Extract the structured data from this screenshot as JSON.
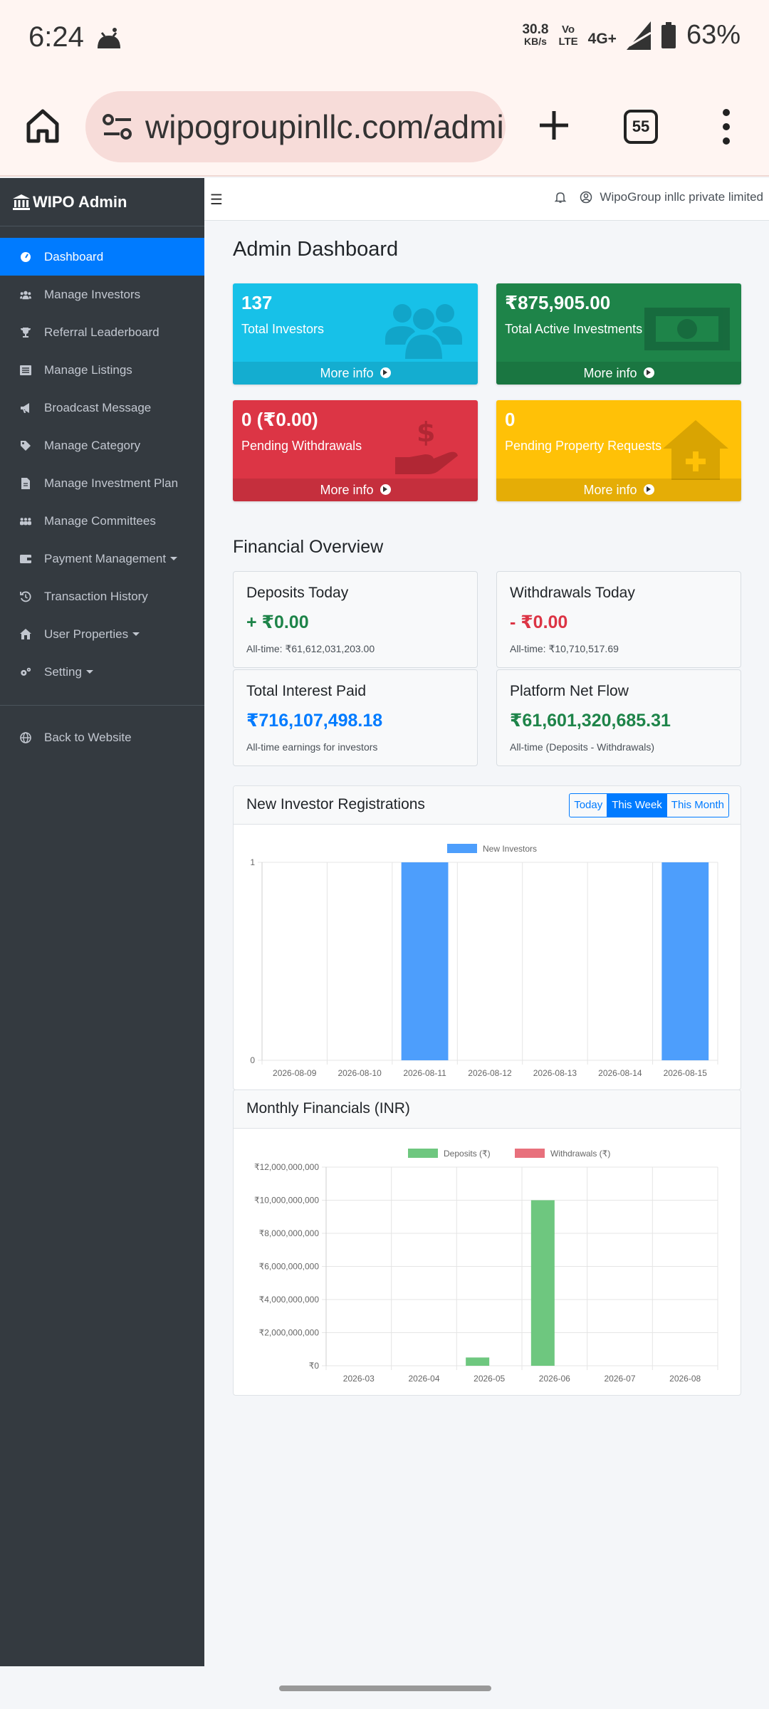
{
  "status_bar": {
    "time": "6:24",
    "speed_value": "30.8",
    "speed_unit": "KB/s",
    "volte_top": "Vo",
    "volte_bottom": "LTE",
    "network": "4G+",
    "battery": "63%"
  },
  "browser": {
    "url": "wipogroupinllc.com/admin/dashboard",
    "tab_count": "55"
  },
  "sidebar": {
    "brand": "WIPO Admin",
    "items": [
      {
        "label": "Dashboard",
        "icon": "gauge-icon",
        "active": true
      },
      {
        "label": "Manage Investors",
        "icon": "users-icon"
      },
      {
        "label": "Referral Leaderboard",
        "icon": "trophy-icon"
      },
      {
        "label": "Manage Listings",
        "icon": "list-icon"
      },
      {
        "label": "Broadcast Message",
        "icon": "megaphone-icon"
      },
      {
        "label": "Manage Category",
        "icon": "tags-icon"
      },
      {
        "label": "Manage Investment Plan",
        "icon": "file-icon"
      },
      {
        "label": "Manage Committees",
        "icon": "group-icon"
      },
      {
        "label": "Payment Management",
        "icon": "wallet-icon",
        "dropdown": true
      },
      {
        "label": "Transaction History",
        "icon": "history-icon"
      },
      {
        "label": "User Properties",
        "icon": "house-icon",
        "dropdown": true
      },
      {
        "label": "Setting",
        "icon": "gears-icon",
        "dropdown": true
      }
    ],
    "back_label": "Back to Website"
  },
  "topbar": {
    "user": "WipoGroup inllc private limited"
  },
  "page_title": "Admin Dashboard",
  "stats": [
    {
      "value": "137",
      "label": "Total Investors",
      "more": "More info",
      "color": "#17c1e8",
      "icon": "users-icon"
    },
    {
      "value": "₹875,905.00",
      "label": "Total Active Investments",
      "more": "More info",
      "color": "#1e8449",
      "icon": "money-icon"
    },
    {
      "value": "0 (₹0.00)",
      "label": "Pending Withdrawals",
      "more": "More info",
      "color": "#dc3545",
      "icon": "hand-dollar-icon"
    },
    {
      "value": "0",
      "label": "Pending Property Requests",
      "more": "More info",
      "color": "#ffc107",
      "icon": "house-plus-icon"
    }
  ],
  "financial": {
    "title": "Financial Overview",
    "cards": [
      {
        "title": "Deposits Today",
        "value": "+ ₹0.00",
        "sub": "All-time: ₹61,612,031,203.00",
        "color": "#1e8449"
      },
      {
        "title": "Withdrawals Today",
        "value": "- ₹0.00",
        "sub": "All-time: ₹10,710,517.69",
        "color": "#dc3545"
      },
      {
        "title": "Total Interest Paid",
        "value": "₹716,107,498.18",
        "sub": "All-time earnings for investors",
        "color": "#007bff"
      },
      {
        "title": "Platform Net Flow",
        "value": "₹61,601,320,685.31",
        "sub": "All-time (Deposits - Withdrawals)",
        "color": "#1e8449"
      }
    ]
  },
  "registrations": {
    "title": "New Investor Registrations",
    "filters": [
      "Today",
      "This Week",
      "This Month"
    ],
    "active_filter": "This Week"
  },
  "monthly": {
    "title": "Monthly Financials (INR)"
  },
  "chart_data": [
    {
      "type": "bar",
      "title": "",
      "categories": [
        "2026-08-09",
        "2026-08-10",
        "2026-08-11",
        "2026-08-12",
        "2026-08-13",
        "2026-08-14",
        "2026-08-15"
      ],
      "series": [
        {
          "name": "New Investors",
          "values": [
            0,
            0,
            1,
            0,
            0,
            0,
            1
          ],
          "color": "#4d9efc"
        }
      ],
      "ylim": [
        0,
        1
      ],
      "yticks": [
        "0",
        "1"
      ],
      "grid": true,
      "legend": "top"
    },
    {
      "type": "bar",
      "title": "",
      "categories": [
        "2026-03",
        "2026-04",
        "2026-05",
        "2026-06",
        "2026-07",
        "2026-08"
      ],
      "series": [
        {
          "name": "Deposits (₹)",
          "values": [
            0,
            0,
            500000000,
            10000000000,
            0,
            0
          ],
          "color": "#6ec77f"
        },
        {
          "name": "Withdrawals (₹)",
          "values": [
            0,
            0,
            0,
            0,
            0,
            0
          ],
          "color": "#e8707c"
        }
      ],
      "ylim": [
        0,
        12000000000
      ],
      "yticks": [
        "₹0",
        "₹2,000,000,000",
        "₹4,000,000,000",
        "₹6,000,000,000",
        "₹8,000,000,000",
        "₹10,000,000,000",
        "₹12,000,000,000"
      ],
      "grid": true,
      "legend": "top"
    }
  ]
}
